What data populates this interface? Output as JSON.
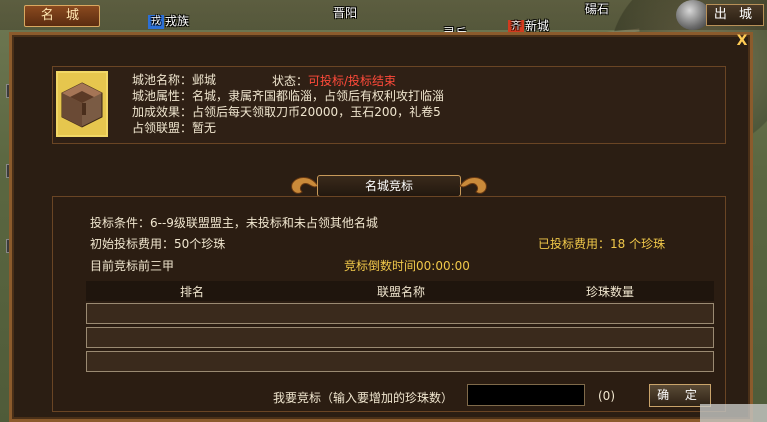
{
  "top_tab": {
    "label": "名 城"
  },
  "exit_button": {
    "label": "出 城"
  },
  "map_labels": {
    "rong": "戎族",
    "jinyang": "晋阳",
    "lingqiu": "灵丘",
    "xincheng": "新城",
    "tangshan": "碭石"
  },
  "close_label": "X",
  "info": {
    "name_label": "城池名称：",
    "name_value": "邺城",
    "status_label": "状态：",
    "status_value": "可投标/投标结束",
    "attr_label": "城池属性：",
    "attr_value": "名城，隶属齐国都临淄，占领后有权利攻打临淄",
    "effect_label": "加成效果：",
    "effect_value": "占领后每天领取刀币20000，玉石200，礼卷5",
    "alliance_label": "占领联盟：",
    "alliance_value": "暂无"
  },
  "section_title": "名城竞标",
  "bid": {
    "condition": "投标条件：6--9级联盟盟主，未投标和未占领其他名城",
    "initial_fee": "初始投标费用：50个珍珠",
    "paid_fee": "已投标费用：18 个珍珠",
    "top_three": "目前竞标前三甲",
    "countdown": "竞标倒数时间00:00:00"
  },
  "table": {
    "columns": [
      "排名",
      "联盟名称",
      "珍珠数量"
    ]
  },
  "bid_form": {
    "prompt": "我要竞标（输入要增加的珍珠数）",
    "input_value": "",
    "count": "(0)",
    "confirm_label": "确 定"
  },
  "colors": {
    "status_red": "#ff4a3a",
    "gold_text": "#f0c84a",
    "frame_brown": "#8b5b2c",
    "panel_bg": "#2b1e13"
  }
}
